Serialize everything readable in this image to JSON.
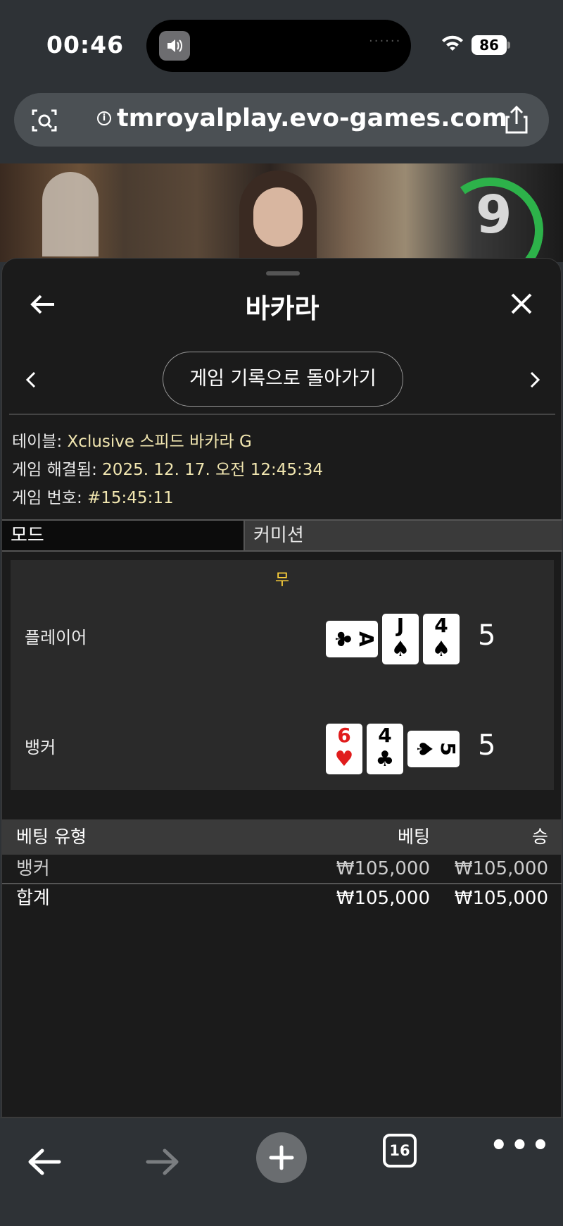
{
  "status": {
    "time": "00:46",
    "battery": "86"
  },
  "browser": {
    "url": "tmroyalplay.evo-games.com",
    "tabs_count": "16"
  },
  "video": {
    "timer": "9"
  },
  "panel": {
    "title": "바카라",
    "history_button": "게임 기록으로 돌아가기",
    "info": {
      "table_label": "테이블: ",
      "table_value": "Xclusive 스피드 바카라 G",
      "resolved_label": "게임 해결됨: ",
      "resolved_value": "2025. 12. 17. 오전 12:45:34",
      "number_label": "게임 번호: ",
      "number_value": "#15:45:11"
    },
    "tabs": [
      "모드",
      "커미션"
    ],
    "result": {
      "outcome": "무",
      "player_label": "플레이어",
      "player_score": "5",
      "banker_label": "뱅커",
      "banker_score": "5",
      "player_cards": [
        {
          "rank": "A",
          "suit": "♣",
          "color": "#000000"
        },
        {
          "rank": "J",
          "suit": "♠",
          "color": "#000000"
        },
        {
          "rank": "4",
          "suit": "♠",
          "color": "#000000"
        }
      ],
      "banker_cards": [
        {
          "rank": "6",
          "suit": "♥",
          "color": "#e01c1c"
        },
        {
          "rank": "4",
          "suit": "♣",
          "color": "#000000"
        },
        {
          "rank": "5",
          "suit": "♠",
          "color": "#000000"
        }
      ]
    },
    "bets": {
      "headers": [
        "베팅 유형",
        "베팅",
        "승"
      ],
      "rows": [
        {
          "type": "뱅커",
          "bet": "₩105,000",
          "win": "₩105,000"
        }
      ],
      "total": {
        "type": "합계",
        "bet": "₩105,000",
        "win": "₩105,000"
      }
    }
  },
  "colors": {
    "accent_yellow": "#ffd23a",
    "timer_green": "#2db24a",
    "info_value": "#f1e6b0"
  }
}
